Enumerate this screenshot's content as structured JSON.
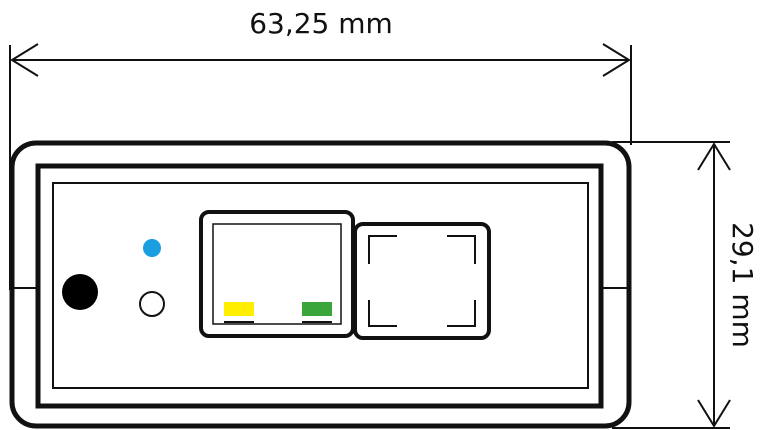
{
  "dimensions": {
    "width_label": "63,25 mm",
    "height_label": "29,1 mm"
  },
  "colors": {
    "outline": "#111111",
    "led_blue": "#1a9ee0",
    "led_yellow": "#ffee00",
    "led_green": "#3aa53a",
    "button_black": "#000000",
    "background": "#ffffff"
  },
  "icons": {
    "power_button": "filled-circle",
    "status_led": "blue-dot",
    "reset_button": "hollow-circle",
    "ethernet_port": "rj45-port",
    "second_port": "port"
  }
}
